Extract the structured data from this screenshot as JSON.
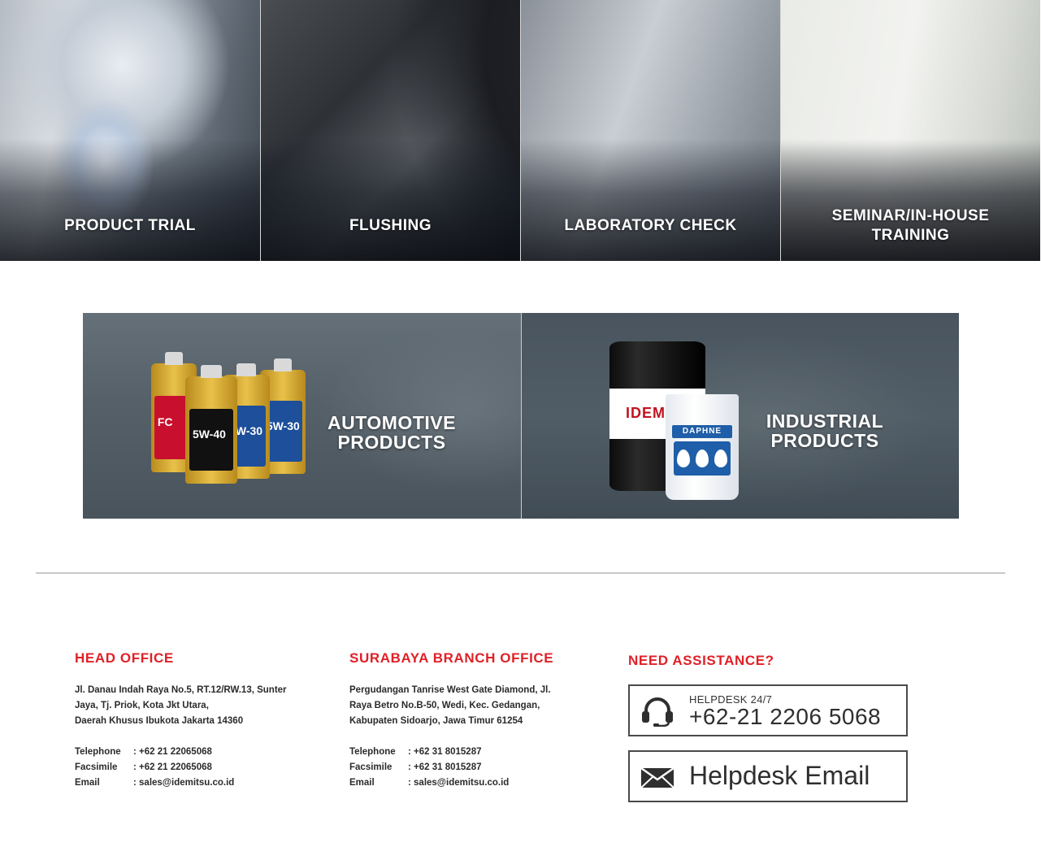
{
  "services": [
    {
      "label": "PRODUCT TRIAL"
    },
    {
      "label": "FLUSHING"
    },
    {
      "label": "LABORATORY CHECK"
    },
    {
      "label": "SEMINAR/IN-HOUSE TRAINING"
    }
  ],
  "products": [
    {
      "label": "AUTOMOTIVE PRODUCTS"
    },
    {
      "label": "INDUSTRIAL PRODUCTS"
    }
  ],
  "product_art": {
    "bottle_grades": [
      "FC",
      "5W-40",
      "5W-30",
      "5W-30"
    ],
    "drum_text": "IDEM",
    "pail_text": "DAPHNE"
  },
  "head_office": {
    "title": "HEAD OFFICE",
    "address": [
      "Jl. Danau Indah Raya No.5, RT.12/RW.13, Sunter",
      "Jaya, Tj. Priok, Kota Jkt Utara,",
      "Daerah Khusus Ibukota Jakarta 14360"
    ],
    "telephone_label": "Telephone",
    "telephone": ": +62 21 22065068",
    "fax_label": "Facsimile",
    "fax": ": +62 21 22065068",
    "email_label": "Email",
    "email": ": sales@idemitsu.co.id"
  },
  "branch_office": {
    "title": "SURABAYA BRANCH OFFICE",
    "address": [
      "Pergudangan Tanrise West Gate Diamond, Jl.",
      "Raya Betro No.B-50, Wedi, Kec. Gedangan,",
      "Kabupaten Sidoarjo, Jawa Timur 61254"
    ],
    "telephone_label": "Telephone",
    "telephone": ": +62 31 8015287",
    "fax_label": "Facsimile",
    "fax": ": +62 31 8015287",
    "email_label": "Email",
    "email": ": sales@idemitsu.co.id"
  },
  "assistance": {
    "title": "NEED ASSISTANCE?",
    "helpdesk_label": "HELPDESK 24/7",
    "helpdesk_phone": "+62-21 2206 5068",
    "helpdesk_email_label": "Helpdesk Email"
  },
  "colors": {
    "accent_red": "#e02027",
    "text_dark": "#2b2b2b",
    "divider": "#c8c8c8"
  },
  "icons": {
    "helpdesk": "headset-icon",
    "email": "envelope-icon"
  }
}
